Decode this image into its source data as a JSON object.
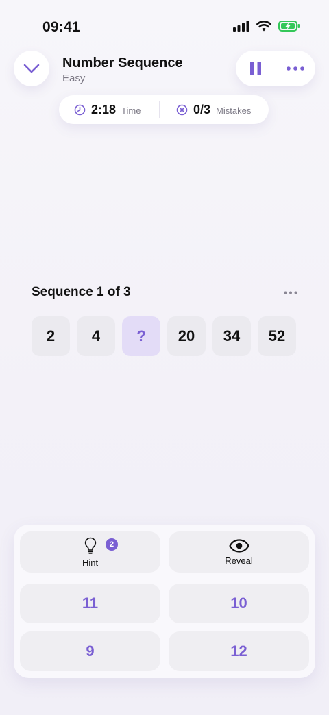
{
  "status_bar": {
    "time": "09:41"
  },
  "header": {
    "title": "Number Sequence",
    "difficulty": "Easy"
  },
  "stats": {
    "time_value": "2:18",
    "time_label": "Time",
    "mistakes_value": "0/3",
    "mistakes_label": "Mistakes"
  },
  "sequence": {
    "title": "Sequence 1 of 3",
    "tiles": [
      {
        "value": "2"
      },
      {
        "value": "4"
      },
      {
        "value": "?"
      },
      {
        "value": "20"
      },
      {
        "value": "34"
      },
      {
        "value": "52"
      }
    ]
  },
  "panel": {
    "hint_label": "Hint",
    "hint_count": "2",
    "reveal_label": "Reveal",
    "answers": [
      "11",
      "10",
      "9",
      "12"
    ]
  },
  "colors": {
    "accent": "#7a5fd3",
    "battery": "#34c759"
  }
}
